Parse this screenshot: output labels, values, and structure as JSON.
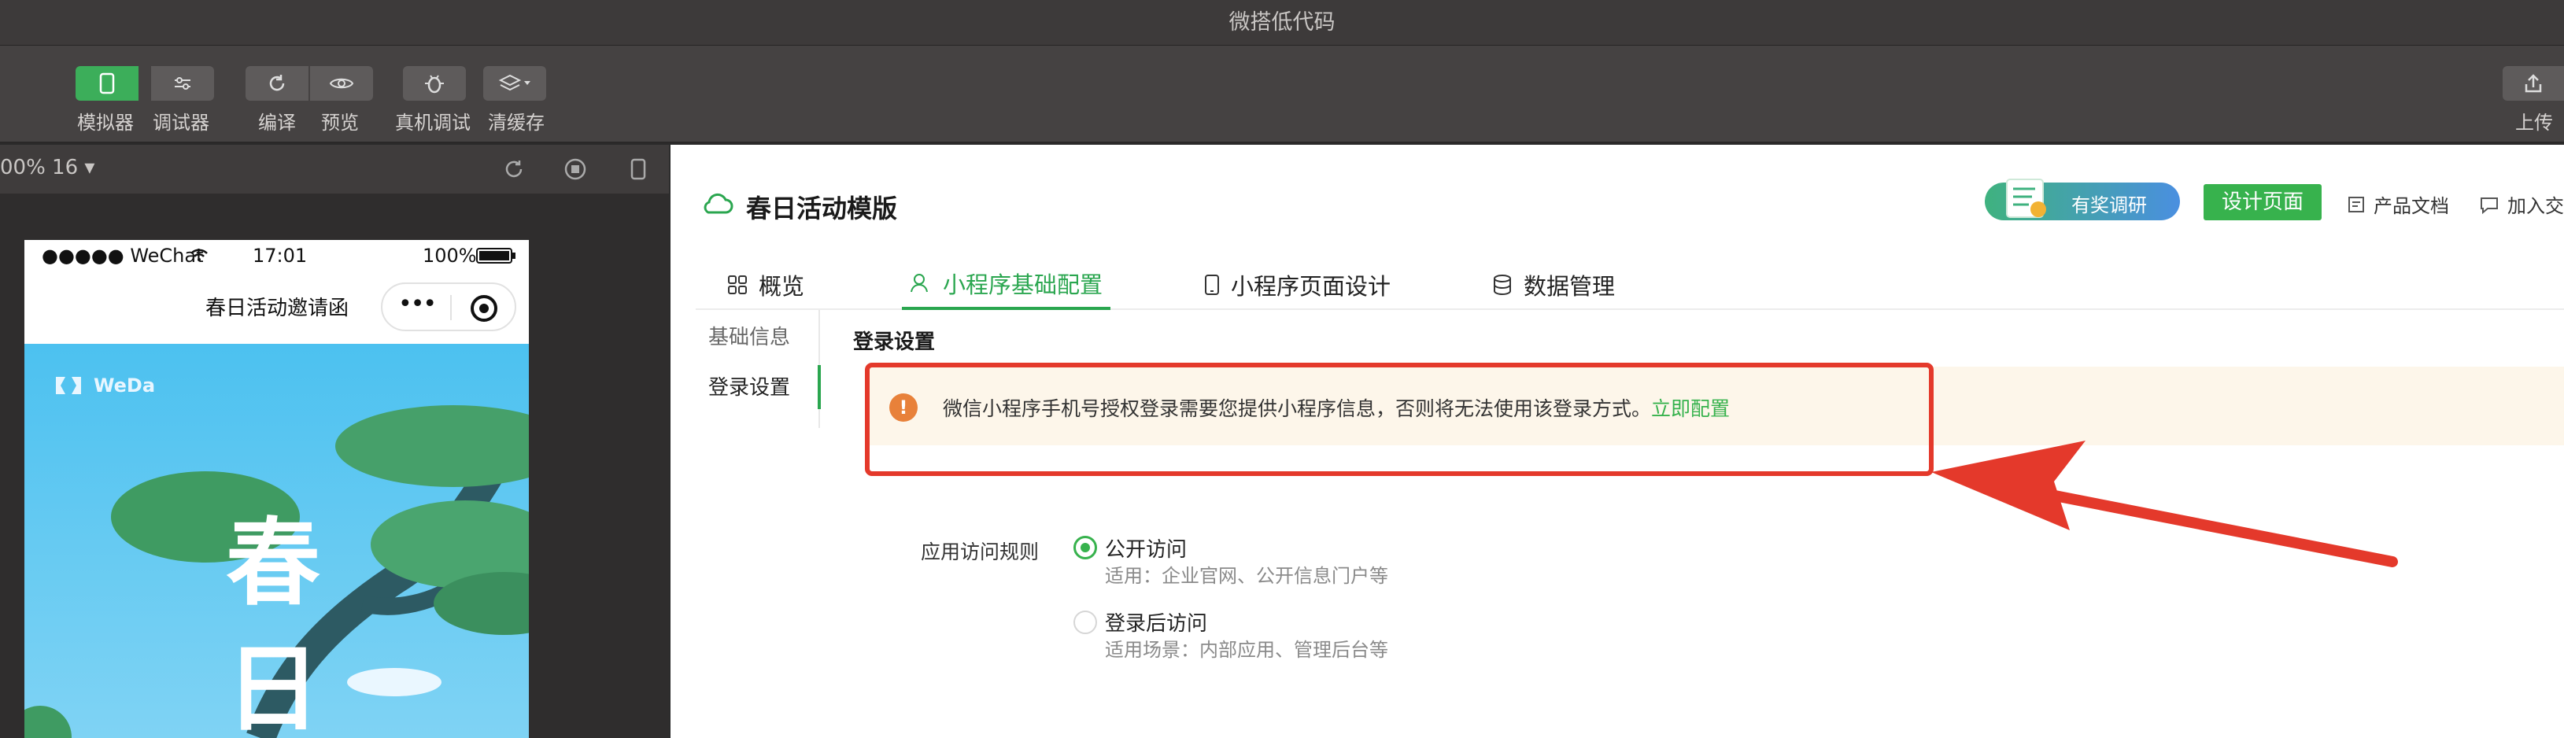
{
  "window": {
    "title": "微搭低代码"
  },
  "toolbar": {
    "simulator": "模拟器",
    "debugger": "调试器",
    "compile": "编译",
    "preview": "预览",
    "device_debug": "真机调试",
    "clear_cache": "清缓存",
    "upload": "上传"
  },
  "simulator": {
    "zoom": "00% 16 ▾",
    "status": {
      "carrier": "●●●●● WeChat",
      "time": "17:01",
      "battery": "100%"
    },
    "nav_title": "春日活动邀请函",
    "capsule_dots": "•••",
    "logo_text": "WeDa",
    "banner_chars": [
      "春",
      "日"
    ]
  },
  "header": {
    "app_name": "春日活动模版",
    "survey": "有奖调研",
    "design_page": "设计页面",
    "product_docs": "产品文档",
    "join": "加入交"
  },
  "tabs": [
    {
      "label": "概览",
      "icon": "grid-icon"
    },
    {
      "label": "小程序基础配置",
      "icon": "user-icon"
    },
    {
      "label": "小程序页面设计",
      "icon": "phone-icon"
    },
    {
      "label": "数据管理",
      "icon": "database-icon"
    }
  ],
  "sidenav": {
    "basic_info": "基础信息",
    "login_settings": "登录设置"
  },
  "content": {
    "section_title": "登录设置",
    "alert_message": "微信小程序手机号授权登录需要您提供小程序信息，否则将无法使用该登录方式。",
    "alert_link": "立即配置",
    "access_rule_label": "应用访问规则",
    "options": [
      {
        "title": "公开访问",
        "desc": "适用：企业官网、公开信息门户等",
        "selected": true
      },
      {
        "title": "登录后访问",
        "desc": "适用场景：内部应用、管理后台等",
        "selected": false
      }
    ]
  },
  "colors": {
    "accent": "#37b24d",
    "annotation": "#e4392b",
    "alert_bg": "#fdf6ea"
  }
}
